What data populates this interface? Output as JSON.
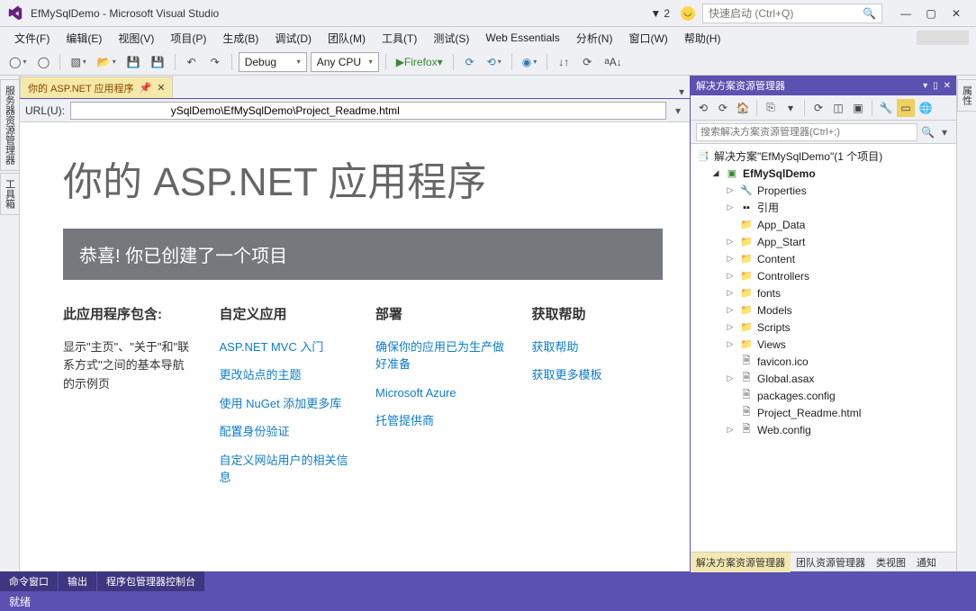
{
  "titlebar": {
    "title": "EfMySqlDemo - Microsoft Visual Studio",
    "notif_count": "2",
    "quicklaunch_placeholder": "快速启动 (Ctrl+Q)"
  },
  "menu": [
    "文件(F)",
    "编辑(E)",
    "视图(V)",
    "项目(P)",
    "生成(B)",
    "调试(D)",
    "团队(M)",
    "工具(T)",
    "测试(S)",
    "Web Essentials",
    "分析(N)",
    "窗口(W)",
    "帮助(H)"
  ],
  "toolbar": {
    "config": "Debug",
    "platform": "Any CPU",
    "run_target": "Firefox"
  },
  "side_left": [
    "服务器资源管理器",
    "工具箱"
  ],
  "side_right": [
    "属性"
  ],
  "doc_tab": "你的 ASP.NET 应用程序",
  "urlbar": {
    "label": "URL(U):",
    "value": "                                ySqlDemo\\EfMySqlDemo\\Project_Readme.html"
  },
  "page": {
    "h1": "你的 ASP.NET 应用程序",
    "banner": "恭喜! 你已创建了一个项目",
    "col1": {
      "h": "此应用程序包含:",
      "p": "显示\"主页\"、\"关于\"和\"联系方式\"之间的基本导航的示例页"
    },
    "col2": {
      "h": "自定义应用",
      "links": [
        "ASP.NET MVC 入门",
        "更改站点的主题",
        "使用 NuGet 添加更多库",
        "配置身份验证",
        "自定义网站用户的相关信息"
      ]
    },
    "col3": {
      "h": "部署",
      "links": [
        "确保你的应用已为生产做好准备",
        "Microsoft Azure",
        "托管提供商"
      ]
    },
    "col4": {
      "h": "获取帮助",
      "links": [
        "获取帮助",
        "获取更多模板"
      ]
    }
  },
  "solution": {
    "title": "解决方案资源管理器",
    "search_placeholder": "搜索解决方案资源管理器(Ctrl+;)",
    "root": "解决方案\"EfMySqlDemo\"(1 个项目)",
    "project": "EfMySqlDemo",
    "nodes": [
      {
        "label": "Properties",
        "icon": "wrench",
        "arrow": ">"
      },
      {
        "label": "引用",
        "icon": "ref",
        "arrow": ">"
      },
      {
        "label": "App_Data",
        "icon": "folder",
        "arrow": ""
      },
      {
        "label": "App_Start",
        "icon": "folder",
        "arrow": ">"
      },
      {
        "label": "Content",
        "icon": "folder",
        "arrow": ">"
      },
      {
        "label": "Controllers",
        "icon": "folder",
        "arrow": ">"
      },
      {
        "label": "fonts",
        "icon": "folder",
        "arrow": ">"
      },
      {
        "label": "Models",
        "icon": "folder",
        "arrow": ">"
      },
      {
        "label": "Scripts",
        "icon": "folder",
        "arrow": ">"
      },
      {
        "label": "Views",
        "icon": "folder",
        "arrow": ">"
      },
      {
        "label": "favicon.ico",
        "icon": "file",
        "arrow": ""
      },
      {
        "label": "Global.asax",
        "icon": "file",
        "arrow": ">"
      },
      {
        "label": "packages.config",
        "icon": "file",
        "arrow": ""
      },
      {
        "label": "Project_Readme.html",
        "icon": "file",
        "arrow": ""
      },
      {
        "label": "Web.config",
        "icon": "file",
        "arrow": ">"
      }
    ],
    "tabs": [
      "解决方案资源管理器",
      "团队资源管理器",
      "类视图",
      "通知"
    ]
  },
  "bottom_tabs": [
    "命令窗口",
    "输出",
    "程序包管理器控制台"
  ],
  "status": "就绪"
}
